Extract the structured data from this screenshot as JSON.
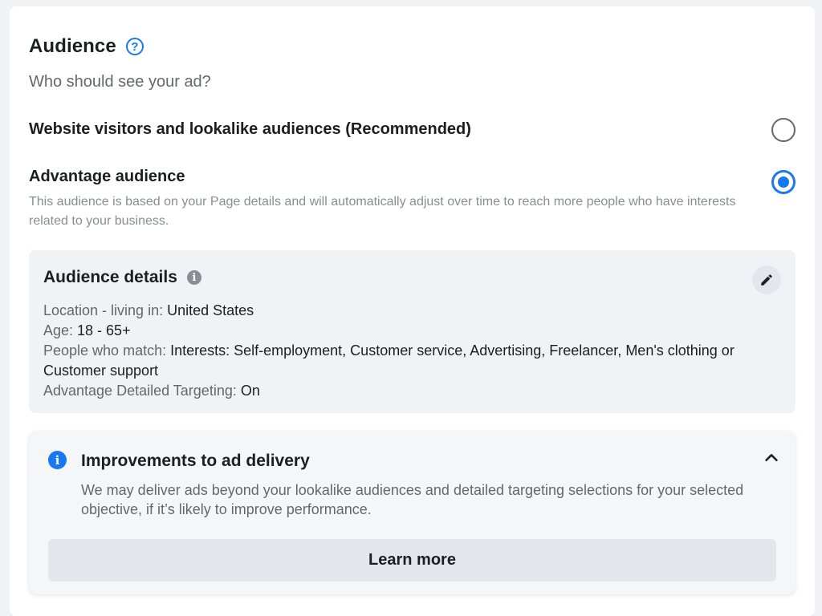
{
  "audience": {
    "title": "Audience",
    "help_icon": "?",
    "subtitle": "Who should see your ad?"
  },
  "options": {
    "website": {
      "label": "Website visitors and lookalike audiences (Recommended)",
      "selected": false
    },
    "advantage": {
      "label": "Advantage audience",
      "description": "This audience is based on your Page details and will automatically adjust over time to reach more people who have interests related to your business.",
      "selected": true
    }
  },
  "details": {
    "title": "Audience details",
    "info_icon": "i",
    "location_label": "Location - living in: ",
    "location_value": "United States",
    "age_label": "Age: ",
    "age_value": "18 - 65+",
    "match_label": "People who match: ",
    "match_value": "Interests: Self-employment, Customer service, Advertising, Freelancer, Men's clothing or Customer support",
    "targeting_label": "Advantage Detailed Targeting: ",
    "targeting_value": "On"
  },
  "improvements": {
    "info_icon": "i",
    "title": "Improvements to ad delivery",
    "text": "We may deliver ads beyond your lookalike audiences and detailed targeting selections for your selected objective, if it’s likely to improve performance.",
    "learn_more_label": "Learn more"
  },
  "colors": {
    "accent": "#1877f2",
    "page_bg": "#f0f2f5",
    "card_bg": "#ffffff",
    "text_primary": "#1c1e21",
    "text_secondary": "#65676b"
  },
  "icons": {
    "help": "question-circle-icon",
    "details_info": "info-circle-icon",
    "edit": "pencil-icon",
    "improvements_info": "info-circle-icon",
    "collapse": "chevron-up-icon"
  }
}
